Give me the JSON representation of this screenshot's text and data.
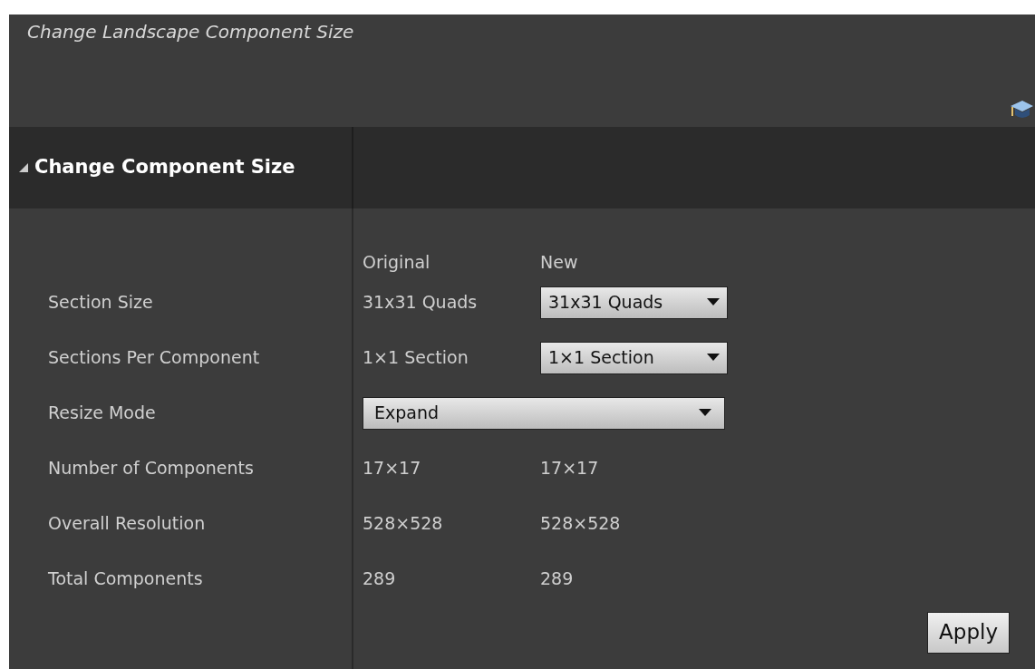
{
  "window": {
    "title": "Change Landscape Component Size"
  },
  "section": {
    "title": "Change Component Size",
    "expanded": true
  },
  "columns": [
    "Original",
    "New"
  ],
  "rows": [
    {
      "kind": "combo",
      "label": "Section Size",
      "original": "31x31 Quads",
      "new": "31x31 Quads"
    },
    {
      "kind": "combo",
      "label": "Sections Per Component",
      "original": "1×1 Section",
      "new": "1×1 Section"
    },
    {
      "kind": "wide_combo",
      "label": "Resize Mode",
      "value": "Expand"
    },
    {
      "kind": "text",
      "label": "Number of Components",
      "original": "17×17",
      "new": "17×17"
    },
    {
      "kind": "text",
      "label": "Overall Resolution",
      "original": "528×528",
      "new": "528×528"
    },
    {
      "kind": "text",
      "label": "Total Components",
      "original": "289",
      "new": "289"
    }
  ],
  "apply_button": "Apply"
}
